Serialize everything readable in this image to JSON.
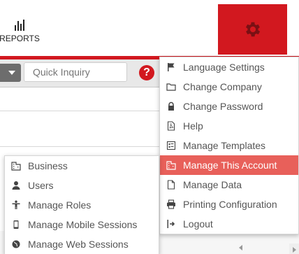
{
  "header": {
    "reports_label": "REPORTS",
    "reports_icon": "bar-chart-icon",
    "settings_icon": "gear-icon",
    "accent": "#d2181f"
  },
  "toolbar": {
    "quick_inquiry_placeholder": "Quick Inquiry",
    "help_symbol": "?"
  },
  "settings_menu": {
    "items": [
      {
        "label": "Language Settings",
        "icon": "flag-icon"
      },
      {
        "label": "Change Company",
        "icon": "folder-icon"
      },
      {
        "label": "Change Password",
        "icon": "lock-icon"
      },
      {
        "label": "Help",
        "icon": "pdf-icon"
      },
      {
        "label": "Manage Templates",
        "icon": "template-icon"
      },
      {
        "label": "Manage This Account",
        "icon": "building-icon",
        "active": true
      },
      {
        "label": "Manage Data",
        "icon": "file-icon"
      },
      {
        "label": "Printing Configuration",
        "icon": "printer-icon"
      },
      {
        "label": "Logout",
        "icon": "logout-icon"
      }
    ],
    "active_color": "#e8605a"
  },
  "account_submenu": {
    "items": [
      {
        "label": "Business",
        "icon": "building-icon"
      },
      {
        "label": "Users",
        "icon": "user-icon"
      },
      {
        "label": "Manage Roles",
        "icon": "person-role-icon"
      },
      {
        "label": "Manage Mobile Sessions",
        "icon": "mobile-icon"
      },
      {
        "label": "Manage Web Sessions",
        "icon": "globe-icon"
      }
    ]
  }
}
